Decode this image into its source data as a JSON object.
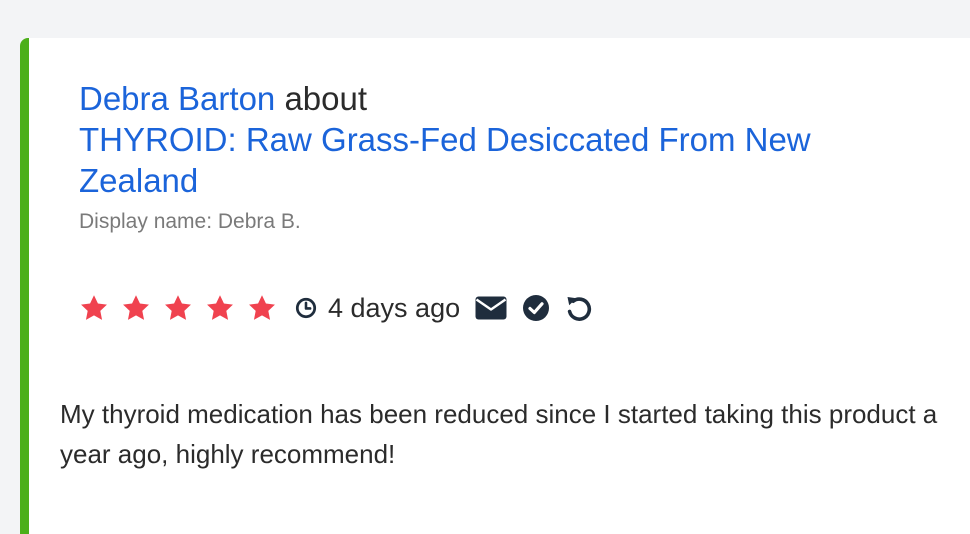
{
  "review": {
    "author": "Debra Barton",
    "about_word": "about",
    "product": "THYROID: Raw Grass-Fed Desiccated From New Zealand",
    "display_name": "Display name: Debra B.",
    "rating": 5,
    "rating_max": 5,
    "time_ago": "4 days ago",
    "body": "My thyroid medication has been reduced since I started taking this product a year ago, highly recommend!"
  },
  "icons": {
    "star": "star-icon",
    "clock": "clock-icon",
    "email": "envelope-icon",
    "verified": "check-circle-icon",
    "undo": "undo-icon"
  },
  "colors": {
    "accent_bar": "#4caf1a",
    "link": "#1b64da",
    "star": "#f0424f",
    "icon_dark": "#1f2d3d",
    "muted_text": "#7a7a7a",
    "body_text": "#2b2b2b"
  }
}
